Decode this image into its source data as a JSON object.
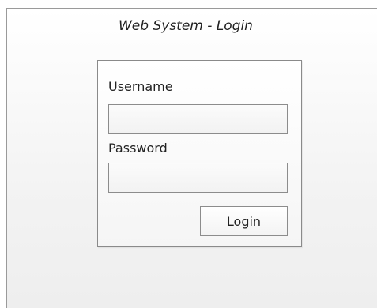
{
  "page": {
    "title": "Web System - Login"
  },
  "login_form": {
    "username_label": "Username",
    "username_value": "",
    "password_label": "Password",
    "password_value": "",
    "submit_label": "Login"
  }
}
